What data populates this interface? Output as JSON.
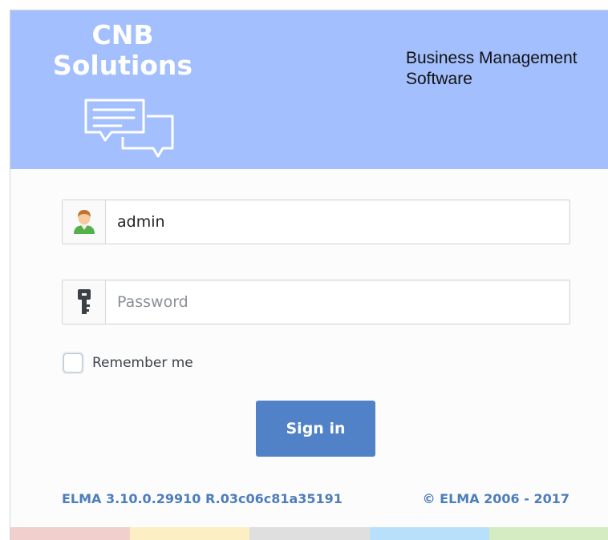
{
  "header": {
    "logo_line1": "CNB",
    "logo_line2": "Solutions",
    "tagline_line1": "Business Management",
    "tagline_line2": "Software",
    "logo_icon": "chat-bubbles-icon"
  },
  "login": {
    "username_value": "admin",
    "username_icon": "user-avatar-icon",
    "password_placeholder": "Password",
    "password_icon": "key-icon",
    "remember_label": "Remember me",
    "remember_checked": false,
    "signin_label": "Sign in"
  },
  "footer": {
    "version": "ELMA 3.10.0.29910 R.03c06c81a35191",
    "copyright": "© ELMA 2006 - 2017"
  },
  "colors": {
    "header_bg": "#a3bffd",
    "button_bg": "#5181c7",
    "footer_text": "#4d7dbb",
    "stripe": [
      "#f0cfcd",
      "#fdefc4",
      "#dfdfdf",
      "#b9e0fb",
      "#d5ebc1"
    ]
  }
}
